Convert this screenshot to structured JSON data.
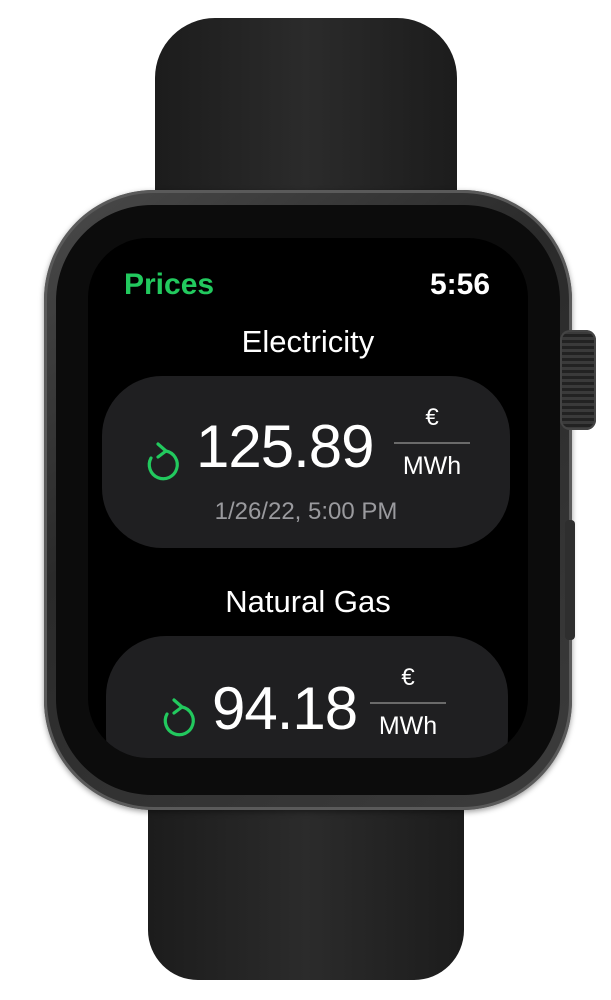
{
  "app": {
    "title": "Prices",
    "time": "5:56"
  },
  "colors": {
    "accent": "#22c95e",
    "card": "#1f1f21",
    "secondary_text": "#9a9a9e"
  },
  "sections": [
    {
      "title": "Electricity",
      "price": "125.89",
      "unit_numerator": "€",
      "unit_denominator": "MWh",
      "timestamp": "1/26/22, 5:00 PM",
      "icon": "refresh-icon"
    },
    {
      "title": "Natural Gas",
      "price": "94.18",
      "unit_numerator": "€",
      "unit_denominator": "MWh",
      "icon": "refresh-icon"
    }
  ]
}
